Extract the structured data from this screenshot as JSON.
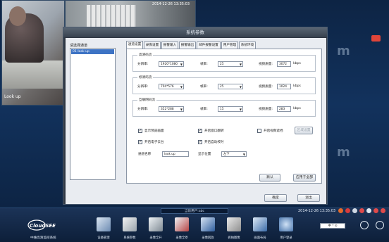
{
  "video": {
    "cam1_label": "Look up",
    "cam2_timestamp": "2014-12-26 13:35:03"
  },
  "watermark": {
    "text1": "m",
    "text2": "m"
  },
  "dialog": {
    "title": "系统参数",
    "channel_list_label": "请选择通道",
    "channel_item": "01-look up",
    "tabs": [
      "通道设置",
      "录像设置",
      "报警输入",
      "报警输出",
      "邮件报警设置",
      "用户管理",
      "系统环境"
    ],
    "groups": {
      "main": {
        "label": "高清码流",
        "resolution_label": "分辨率:",
        "resolution_value": "1920*1080",
        "fps_label": "帧率:",
        "fps_value": "25",
        "quality_label": "视频质量:",
        "quality_value": "3072",
        "unit": "kbps"
      },
      "sub": {
        "label": "标清码流",
        "resolution_label": "分辨率:",
        "resolution_value": "704*576",
        "fps_label": "帧率:",
        "fps_value": "25",
        "quality_label": "视频质量:",
        "quality_value": "1024",
        "unit": "kbps"
      },
      "net": {
        "label": "互联网码流",
        "resolution_label": "分辨率:",
        "resolution_value": "352*288",
        "fps_label": "帧率:",
        "fps_value": "15",
        "quality_label": "视频质量:",
        "quality_value": "283",
        "unit": "kbps"
      }
    },
    "options": {
      "show_frame": "显示预览画面",
      "window_flip": "开启窗口翻转",
      "video_mirror": "开启视频遮挡",
      "ptz": "开启电子云台",
      "auto_time": "开启自动校时",
      "mirror_setting_btn": "区域设置"
    },
    "channel_name_label": "通道名称",
    "channel_name_value": "look up",
    "display_pos_label": "显示位置",
    "display_pos_value": "左下",
    "default_btn": "默认",
    "apply_all_btn": "应用于全部",
    "ok_btn": "确定",
    "exit_btn": "退出"
  },
  "taskbar": {
    "current_user": "当前用户:abc",
    "clock": "2014-12-26 13:35:03",
    "logo": "CloudSEE",
    "app_name": "中维高清监控系统",
    "dock": [
      "设备管理",
      "系统参数",
      "录像全开",
      "录像全停",
      "录像回放",
      "抓拍图像",
      "画面布局",
      "用户登录"
    ],
    "keyboard": "中 ⁹ ⊙"
  }
}
